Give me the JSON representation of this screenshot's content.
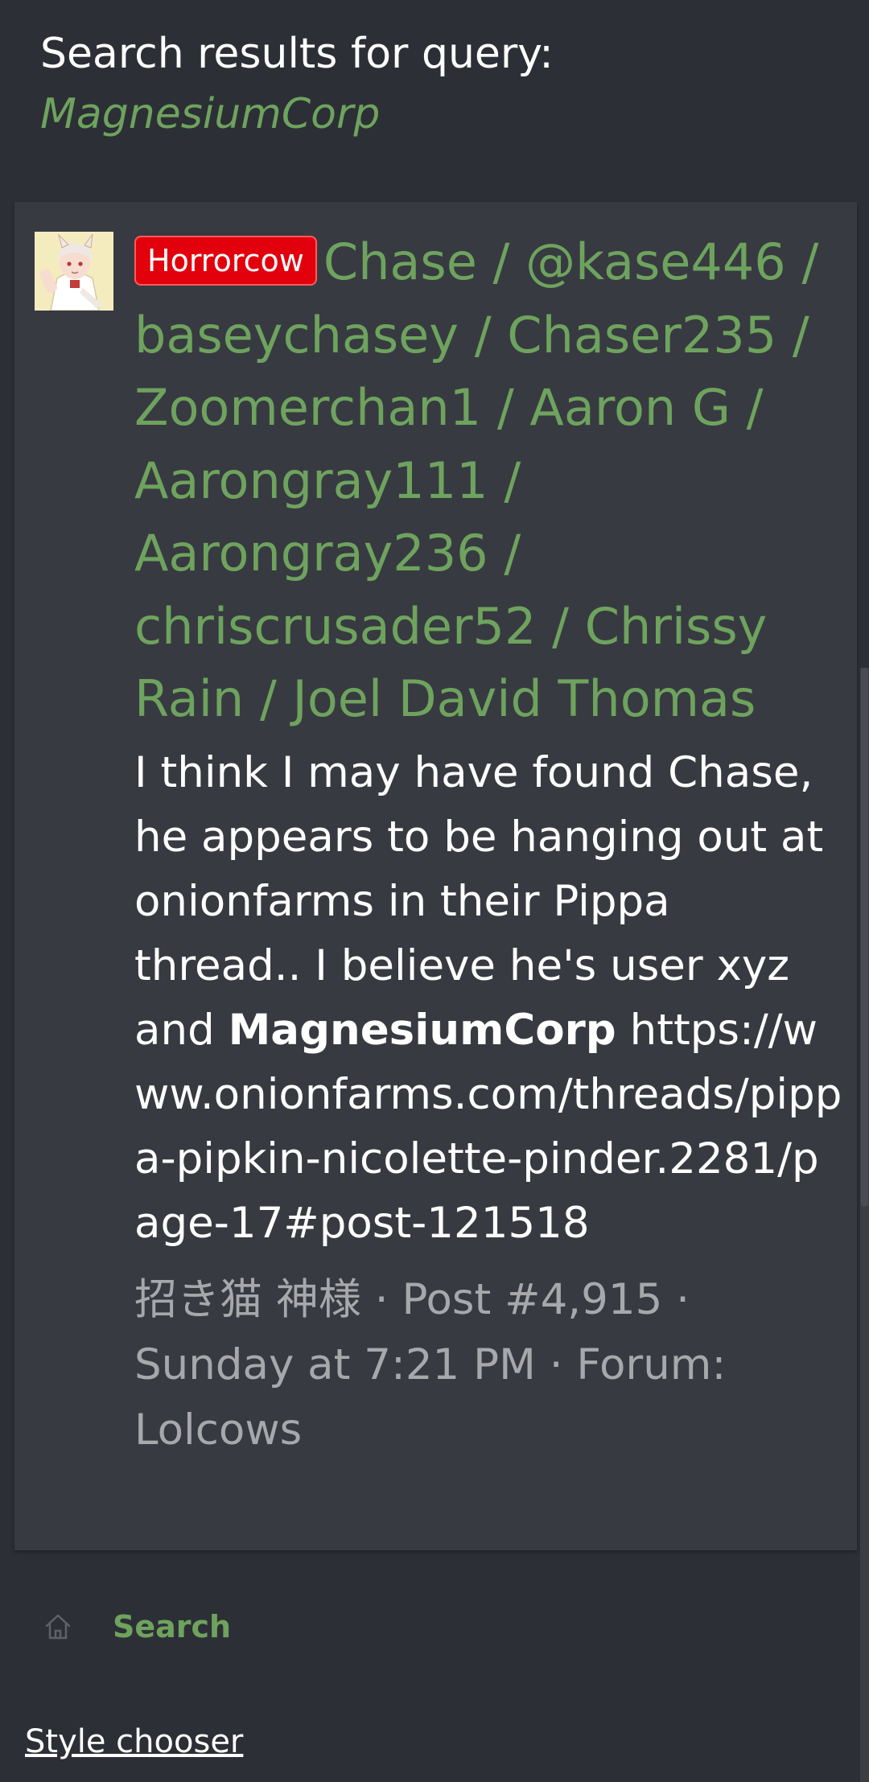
{
  "header": {
    "label": "Search results for query:",
    "query": "MagnesiumCorp"
  },
  "result": {
    "prefix_badge": "Horrorcow",
    "title": "Chase / @kase446 / baseychasey / Chaser235 / Zoomerchan1 / Aaron G / Aarongray111 / Aarongray236 / chriscrusader52 / Chrissy Rain / Joel David Thomas",
    "snippet_before": "I think I may have found Chase, he appears to be hanging out at onionfarms in their Pippa thread.. I believe he's user xyz and ",
    "snippet_highlight": "MagnesiumCorp",
    "snippet_after": " https://www.onionfarms.com/threads/pippa-pipkin-nicolette-pinder.2281/page-17#post-121518",
    "meta": {
      "author": "招き猫 神様",
      "post": "Post #4,915",
      "date": "Sunday at 7:21 PM",
      "forum_label": "Forum:",
      "forum": "Lolcows"
    }
  },
  "breadcrumb": {
    "home_icon": "home-icon",
    "search_label": "Search"
  },
  "footer": {
    "style_chooser": "Style chooser"
  },
  "colors": {
    "background": "#2d2f36",
    "card": "#383a41",
    "accent_green": "#6ea35e",
    "badge_red": "#e1000c",
    "meta_gray": "#a7a8ab"
  }
}
